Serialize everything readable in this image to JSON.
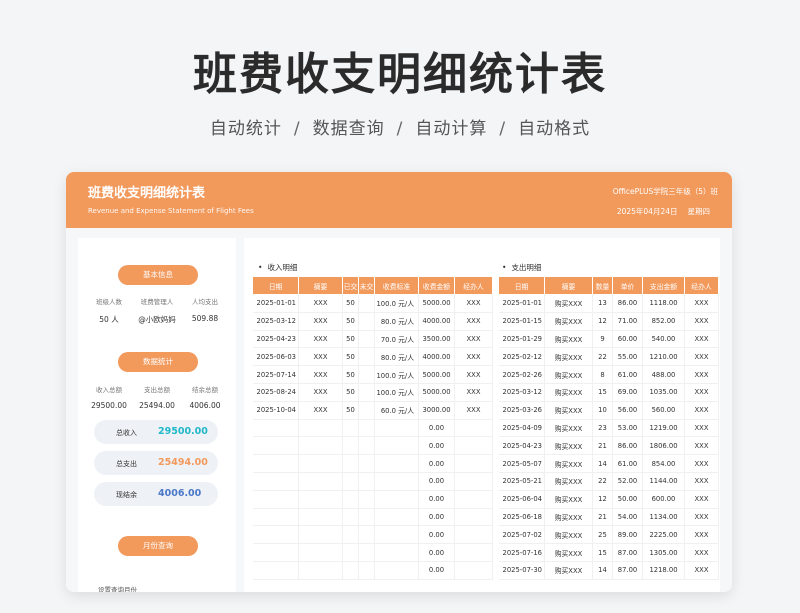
{
  "hero": {
    "title": "班费收支明细统计表",
    "subtitle_items": [
      "自动统计",
      "数据查询",
      "自动计算",
      "自动格式"
    ],
    "separator": "/"
  },
  "header": {
    "title": "班费收支明细统计表",
    "subtitle_en": "Revenue and Expense Statement of Flight Fees",
    "org": "OfficePLUS学院三年级（5）班",
    "date": "2025年04月24日",
    "weekday": "星期四"
  },
  "colors": {
    "accent": "#f2995c",
    "income": "#1fb8c8",
    "expense": "#f2995c",
    "balance": "#4a78c8"
  },
  "left": {
    "basic_info": {
      "button": "基本信息",
      "labels": [
        "班级人数",
        "班费管理人",
        "人均支出"
      ],
      "values": [
        "50 人",
        "@小欧妈妈",
        "509.88"
      ]
    },
    "stats": {
      "button": "数据统计",
      "labels": [
        "收入总额",
        "支出总额",
        "结余总额"
      ],
      "values": [
        "29500.00",
        "25494.00",
        "4006.00"
      ]
    },
    "summary": [
      {
        "label": "总收入",
        "value": "29500.00"
      },
      {
        "label": "总支出",
        "value": "25494.00"
      },
      {
        "label": "现结余",
        "value": "4006.00"
      }
    ],
    "month": {
      "button": "月份查询",
      "label": "设置查询月份"
    }
  },
  "income": {
    "title": "收入明细",
    "headers": [
      "日期",
      "摘要",
      "已交",
      "未交",
      "收费标准",
      "收费金额",
      "经办人"
    ],
    "rows": [
      [
        "2025-01-01",
        "XXX",
        "50",
        "",
        "100.0 元/人",
        "5000.00",
        "XXX"
      ],
      [
        "2025-03-12",
        "XXX",
        "50",
        "",
        "80.0 元/人",
        "4000.00",
        "XXX"
      ],
      [
        "2025-04-23",
        "XXX",
        "50",
        "",
        "70.0 元/人",
        "3500.00",
        "XXX"
      ],
      [
        "2025-06-03",
        "XXX",
        "50",
        "",
        "80.0 元/人",
        "4000.00",
        "XXX"
      ],
      [
        "2025-07-14",
        "XXX",
        "50",
        "",
        "100.0 元/人",
        "5000.00",
        "XXX"
      ],
      [
        "2025-08-24",
        "XXX",
        "50",
        "",
        "100.0 元/人",
        "5000.00",
        "XXX"
      ],
      [
        "2025-10-04",
        "XXX",
        "50",
        "",
        "60.0 元/人",
        "3000.00",
        "XXX"
      ],
      [
        "",
        "",
        "",
        "",
        "",
        "0.00",
        ""
      ],
      [
        "",
        "",
        "",
        "",
        "",
        "0.00",
        ""
      ],
      [
        "",
        "",
        "",
        "",
        "",
        "0.00",
        ""
      ],
      [
        "",
        "",
        "",
        "",
        "",
        "0.00",
        ""
      ],
      [
        "",
        "",
        "",
        "",
        "",
        "0.00",
        ""
      ],
      [
        "",
        "",
        "",
        "",
        "",
        "0.00",
        ""
      ],
      [
        "",
        "",
        "",
        "",
        "",
        "0.00",
        ""
      ],
      [
        "",
        "",
        "",
        "",
        "",
        "0.00",
        ""
      ],
      [
        "",
        "",
        "",
        "",
        "",
        "0.00",
        ""
      ]
    ]
  },
  "expense": {
    "title": "支出明细",
    "headers": [
      "日期",
      "摘要",
      "数量",
      "单价",
      "支出金额",
      "经办人"
    ],
    "rows": [
      [
        "2025-01-01",
        "购买XXX",
        "13",
        "86.00",
        "1118.00",
        "XXX"
      ],
      [
        "2025-01-15",
        "购买XXX",
        "12",
        "71.00",
        "852.00",
        "XXX"
      ],
      [
        "2025-01-29",
        "购买XXX",
        "9",
        "60.00",
        "540.00",
        "XXX"
      ],
      [
        "2025-02-12",
        "购买XXX",
        "22",
        "55.00",
        "1210.00",
        "XXX"
      ],
      [
        "2025-02-26",
        "购买XXX",
        "8",
        "61.00",
        "488.00",
        "XXX"
      ],
      [
        "2025-03-12",
        "购买XXX",
        "15",
        "69.00",
        "1035.00",
        "XXX"
      ],
      [
        "2025-03-26",
        "购买XXX",
        "10",
        "56.00",
        "560.00",
        "XXX"
      ],
      [
        "2025-04-09",
        "购买XXX",
        "23",
        "53.00",
        "1219.00",
        "XXX"
      ],
      [
        "2025-04-23",
        "购买XXX",
        "21",
        "86.00",
        "1806.00",
        "XXX"
      ],
      [
        "2025-05-07",
        "购买XXX",
        "14",
        "61.00",
        "854.00",
        "XXX"
      ],
      [
        "2025-05-21",
        "购买XXX",
        "22",
        "52.00",
        "1144.00",
        "XXX"
      ],
      [
        "2025-06-04",
        "购买XXX",
        "12",
        "50.00",
        "600.00",
        "XXX"
      ],
      [
        "2025-06-18",
        "购买XXX",
        "21",
        "54.00",
        "1134.00",
        "XXX"
      ],
      [
        "2025-07-02",
        "购买XXX",
        "25",
        "89.00",
        "2225.00",
        "XXX"
      ],
      [
        "2025-07-16",
        "购买XXX",
        "15",
        "87.00",
        "1305.00",
        "XXX"
      ],
      [
        "2025-07-30",
        "购买XXX",
        "14",
        "87.00",
        "1218.00",
        "XXX"
      ]
    ]
  }
}
